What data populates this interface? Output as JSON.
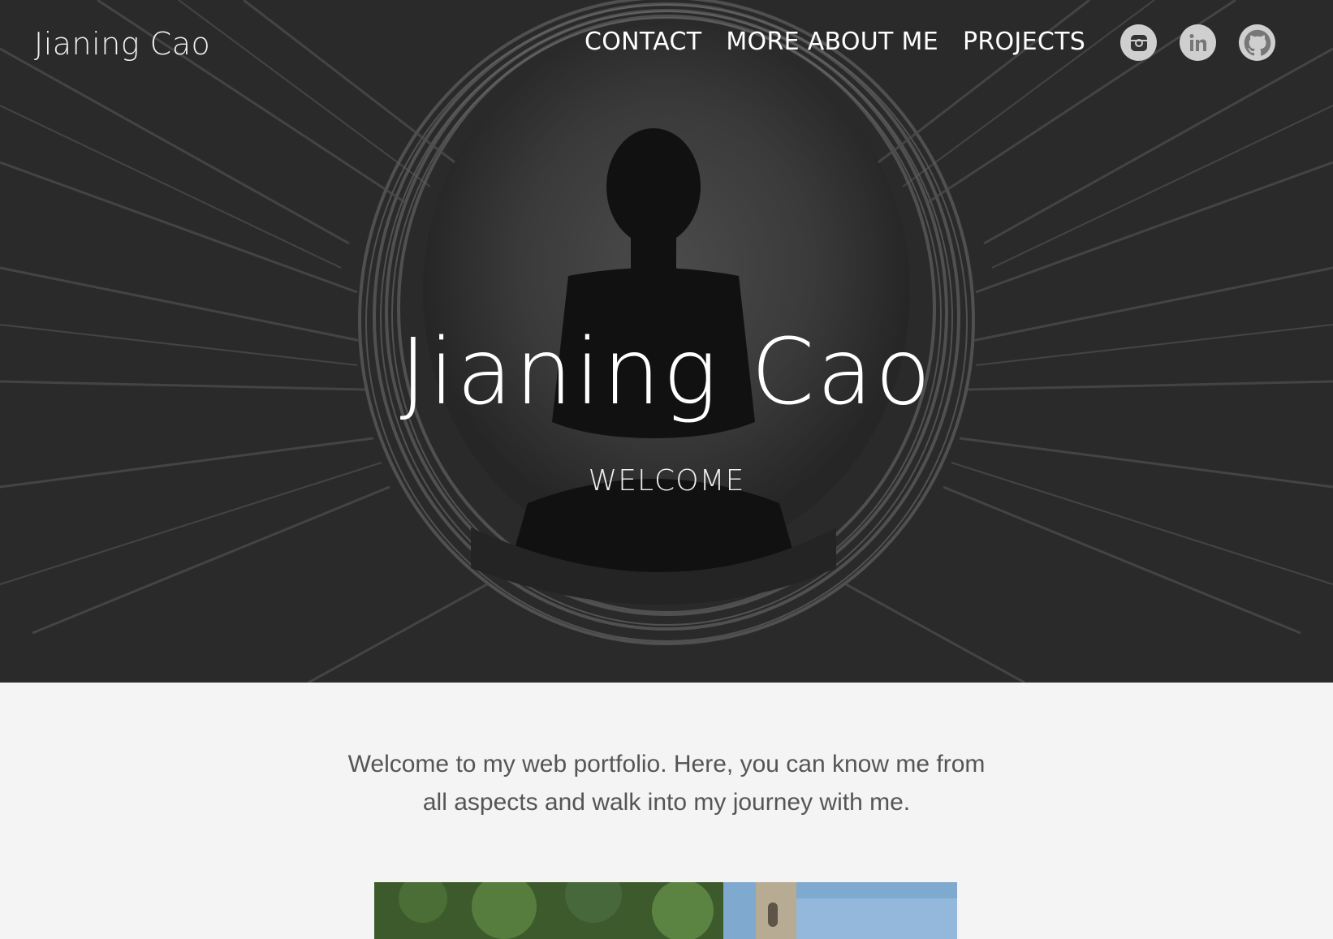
{
  "site": {
    "name": "Jianing Cao"
  },
  "nav": {
    "items": [
      {
        "label": "CONTACT"
      },
      {
        "label": "MORE ABOUT ME"
      },
      {
        "label": "PROJECTS"
      }
    ]
  },
  "social": {
    "icons": [
      "instagram-icon",
      "linkedin-icon",
      "github-icon"
    ]
  },
  "hero": {
    "title": "Jianing Cao",
    "subtitle": "WELCOME"
  },
  "intro": {
    "line1": "Welcome to my web portfolio. Here, you can know me from",
    "line2": "all aspects and walk into my journey with me."
  },
  "colors": {
    "hero_dark": "#2b2b2b",
    "text_light": "#ffffff",
    "intro_text": "#555555",
    "page_bg": "#f4f4f4",
    "icon_bg": "#cfcfcf"
  }
}
